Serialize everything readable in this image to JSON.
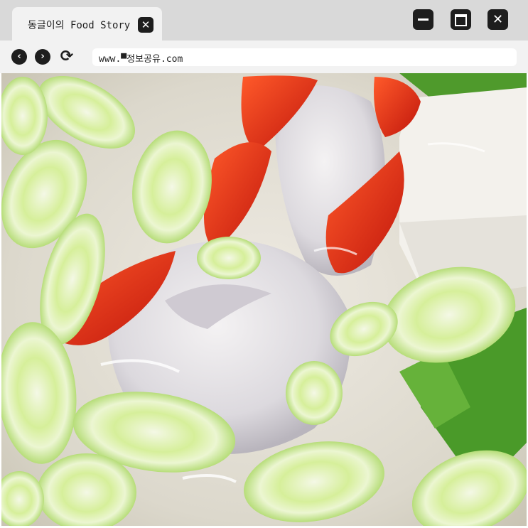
{
  "browser": {
    "tab_title": "동글이의 Food Story",
    "tab_close_icon": "close-icon",
    "window_controls": {
      "minimize_icon": "minimize-icon",
      "maximize_icon": "maximize-icon",
      "close_icon": "close-icon"
    },
    "nav": {
      "back_icon": "chevron-left-icon",
      "forward_icon": "chevron-right-icon",
      "reload_icon": "reload-icon"
    },
    "url": "www.▀정보공유.com"
  },
  "content": {
    "image_subject": "fish-soup-photo"
  },
  "colors": {
    "titlebar": "#d9d9d9",
    "tab": "#f2f2f2",
    "control": "#1e1e1e"
  }
}
